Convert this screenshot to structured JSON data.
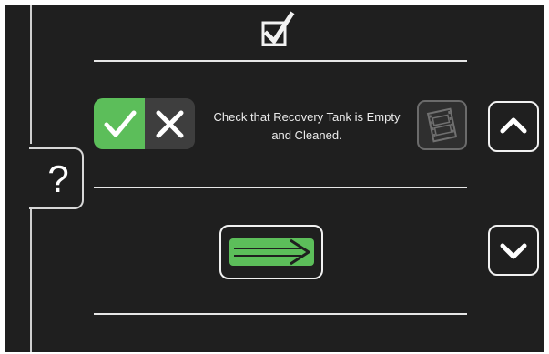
{
  "screen": {
    "background": "#1f1f1f",
    "accent_color": "#5cbe5a",
    "header_icon": "checklist-checkbox-icon"
  },
  "sidebar": {
    "help_label": "?"
  },
  "checklist_item": {
    "instruction_text": "Check that Recovery Tank is Empty\nand Cleaned.",
    "toggle_yes_icon": "checkmark-icon",
    "toggle_no_icon": "x-icon",
    "video_icon": "film-icon",
    "video_enabled": false
  },
  "navigation": {
    "next_icon": "right-arrow-icon",
    "scroll_up_icon": "chevron-up-icon",
    "scroll_down_icon": "chevron-down-icon"
  }
}
